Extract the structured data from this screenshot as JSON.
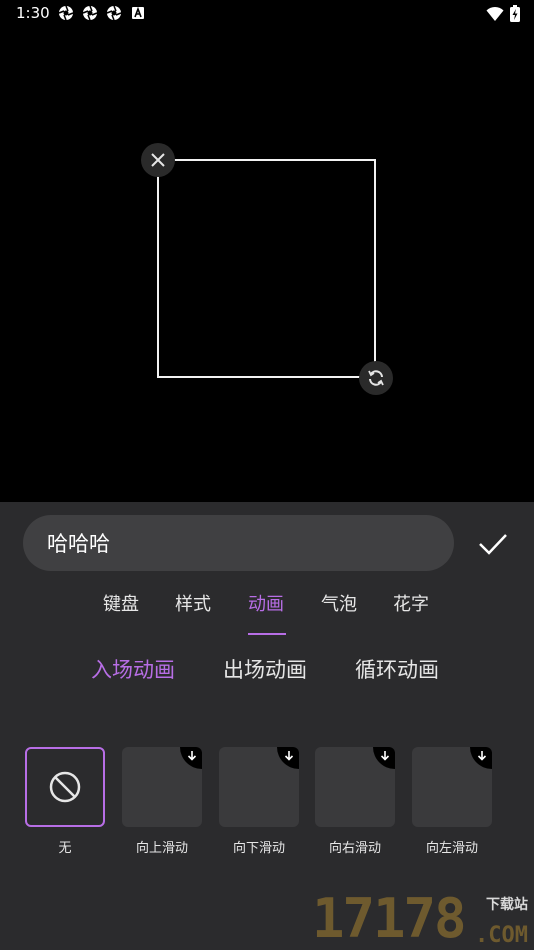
{
  "status_bar": {
    "time": "1:30",
    "left_icons": [
      "aperture-icon",
      "aperture-icon",
      "aperture-icon",
      "a-badge-icon"
    ],
    "right_icons": [
      "wifi-icon",
      "battery-charging-icon"
    ]
  },
  "preview": {
    "close_icon": "close-icon",
    "rotate_icon": "rotate-icon"
  },
  "editor": {
    "input_value": "哈哈哈",
    "confirm_icon": "checkmark-icon"
  },
  "tabs": [
    {
      "label": "键盘",
      "active": false
    },
    {
      "label": "样式",
      "active": false
    },
    {
      "label": "动画",
      "active": true
    },
    {
      "label": "气泡",
      "active": false
    },
    {
      "label": "花字",
      "active": false
    }
  ],
  "subtabs": [
    {
      "label": "入场动画",
      "active": true
    },
    {
      "label": "出场动画",
      "active": false
    },
    {
      "label": "循环动画",
      "active": false
    }
  ],
  "animations": [
    {
      "label": "无",
      "selected": true,
      "icon": "none-icon"
    },
    {
      "label": "向上滑动",
      "selected": false,
      "icon": "download-icon"
    },
    {
      "label": "向下滑动",
      "selected": false,
      "icon": "download-icon"
    },
    {
      "label": "向右滑动",
      "selected": false,
      "icon": "download-icon"
    },
    {
      "label": "向左滑动",
      "selected": false,
      "icon": "download-icon"
    }
  ],
  "watermark": {
    "number": "17178",
    "small_text": "下载站",
    "domain": ".COM"
  },
  "colors": {
    "accent": "#b86ee6",
    "panel_bg": "#2b2b2d",
    "input_bg": "#404042"
  }
}
